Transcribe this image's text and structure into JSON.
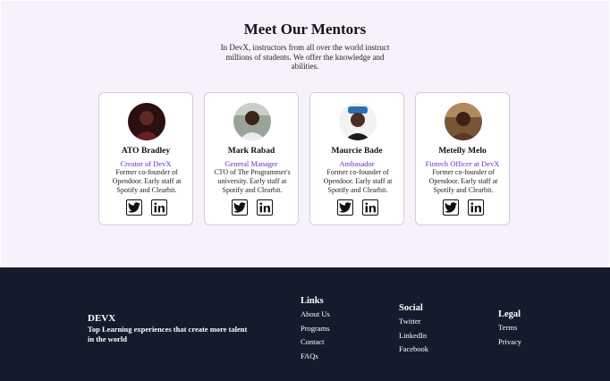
{
  "mentors": {
    "title": "Meet Our Mentors",
    "intro": "In DevX, instructors from all over the world instruct millions of students. We offer the knowledge and abilities.",
    "cards": [
      {
        "name": "ATO Bradley",
        "role": "Creator of DevX",
        "bio": "Former co-founder of Opendoor. Early staff at Spotify and Clearbit."
      },
      {
        "name": "Mark Rabad",
        "role": "General Manager",
        "bio": "CTO of The Programmer's university. Early staff at Spotify and Clearbit."
      },
      {
        "name": "Maurcie Bade",
        "role": "Ambasador",
        "bio": "Former co-founder of Opendoor. Early staff at Spotify and Clearbit."
      },
      {
        "name": "Metelly Melo",
        "role": "Fintech Officer at DevX",
        "bio": "Former co-founder of Opendoor. Early staff at Spotify and Clearbit."
      }
    ]
  },
  "footer": {
    "brand": "DEVX",
    "tagline": "Top Learning experiences that create more talent in the world",
    "links": {
      "title": "Links",
      "items": [
        "About Us",
        "Programs",
        "Contact",
        "FAQs"
      ]
    },
    "social": {
      "title": "Social",
      "items": [
        "Twitter",
        "LinkedIn",
        "Facebook"
      ]
    },
    "legal": {
      "title": "Legal",
      "items": [
        "Terms",
        "Privacy"
      ]
    }
  },
  "icons": {
    "social": [
      "twitter-icon",
      "linkedin-icon"
    ]
  },
  "colors": {
    "section_bg": "#f7f1fc",
    "role_text": "#6a2ec9",
    "footer_bg": "#151b2c"
  }
}
